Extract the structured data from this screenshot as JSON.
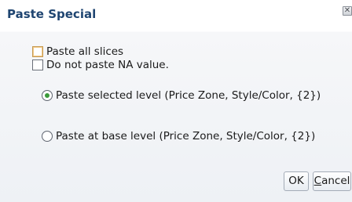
{
  "dialog": {
    "title": "Paste Special",
    "close_glyph": "✕"
  },
  "options": {
    "paste_all_slices": {
      "label": "Paste all slices",
      "checked": false
    },
    "do_not_paste_na": {
      "label": "Do not paste NA value.",
      "checked": false
    }
  },
  "level": {
    "selected_level": {
      "label": "Paste selected level (Price Zone, Style/Color, {2})",
      "checked": true
    },
    "base_level": {
      "label": "Paste at base level (Price Zone, Style/Color, {2})",
      "checked": false
    }
  },
  "buttons": {
    "ok_label": "OK",
    "cancel_label": "Cancel"
  }
}
